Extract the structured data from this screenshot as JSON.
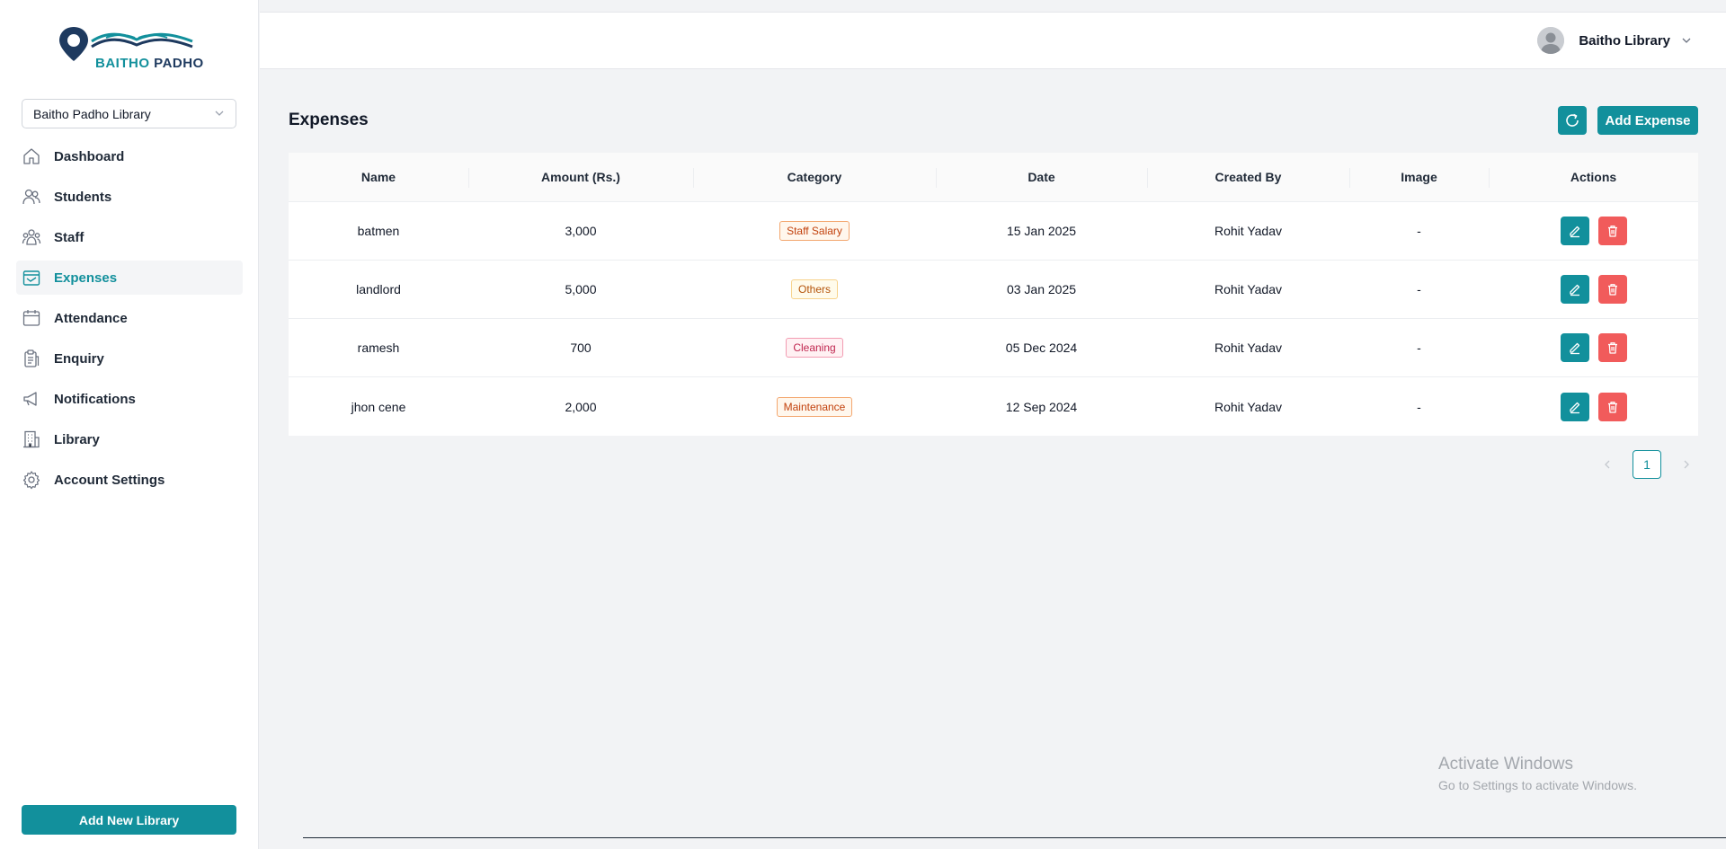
{
  "brand": {
    "name_part1": "BAITHO",
    "name_part2": "PADHO",
    "teal": "#12909c",
    "navy": "#1e3a5f"
  },
  "sidebar": {
    "library_select": "Baitho Padho Library",
    "items": [
      {
        "label": "Dashboard",
        "icon": "home-icon"
      },
      {
        "label": "Students",
        "icon": "users-icon"
      },
      {
        "label": "Staff",
        "icon": "team-icon"
      },
      {
        "label": "Expenses",
        "icon": "wallet-icon",
        "active": true
      },
      {
        "label": "Attendance",
        "icon": "calendar-icon"
      },
      {
        "label": "Enquiry",
        "icon": "clipboard-icon"
      },
      {
        "label": "Notifications",
        "icon": "megaphone-icon"
      },
      {
        "label": "Library",
        "icon": "building-icon"
      },
      {
        "label": "Account Settings",
        "icon": "gear-icon"
      }
    ],
    "add_library_label": "Add New Library"
  },
  "header": {
    "user_name": "Baitho Library"
  },
  "main": {
    "title": "Expenses",
    "add_expense_label": "Add Expense",
    "table": {
      "columns": [
        "Name",
        "Amount (Rs.)",
        "Category",
        "Date",
        "Created By",
        "Image",
        "Actions"
      ],
      "rows": [
        {
          "name": "batmen",
          "amount": "3,000",
          "category": "Staff Salary",
          "category_style": "salary",
          "date": "15 Jan 2025",
          "created_by": "Rohit Yadav",
          "image": "-"
        },
        {
          "name": "landlord",
          "amount": "5,000",
          "category": "Others",
          "category_style": "others",
          "date": "03 Jan 2025",
          "created_by": "Rohit Yadav",
          "image": "-"
        },
        {
          "name": "ramesh",
          "amount": "700",
          "category": "Cleaning",
          "category_style": "cleaning",
          "date": "05 Dec 2024",
          "created_by": "Rohit Yadav",
          "image": "-"
        },
        {
          "name": "jhon cene",
          "amount": "2,000",
          "category": "Maintenance",
          "category_style": "maintenance",
          "date": "12 Sep 2024",
          "created_by": "Rohit Yadav",
          "image": "-"
        }
      ]
    },
    "pagination": {
      "current_page": "1"
    }
  },
  "watermark": {
    "line1": "Activate Windows",
    "line2": "Go to Settings to activate Windows."
  }
}
